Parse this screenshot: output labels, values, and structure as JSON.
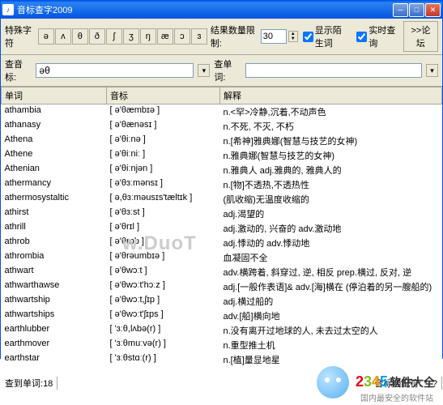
{
  "title": "音标查字2009",
  "toolbar": {
    "special_chars_label": "特殊字符",
    "phonetic_buttons": [
      "ə",
      "ʌ",
      "θ",
      "ð",
      "ʃ",
      "ʒ",
      "ŋ",
      "æ",
      "ɔ",
      "ɜ"
    ],
    "result_limit_label": "结果数量限制:",
    "result_limit_value": "30",
    "show_unknown_label": "显示陌生词",
    "show_unknown_checked": true,
    "realtime_label": "实时查询",
    "realtime_checked": true,
    "forum_label": ">>论坛"
  },
  "search": {
    "phonetic_label": "查音标:",
    "phonetic_value": "əθ",
    "word_label": "查单词:",
    "word_value": ""
  },
  "columns": {
    "word": "单词",
    "phonetic": "音标",
    "meaning": "解释"
  },
  "rows": [
    {
      "w": "athambia",
      "p": "[ ə'θæmbɪə ]",
      "m": "n.<罕>冷静,沉着,不动声色"
    },
    {
      "w": "athanasy",
      "p": "[ ə'θænəsɪ ]",
      "m": "n.不死, 不灭, 不朽"
    },
    {
      "w": "Athena",
      "p": "[ ə'θiːnə ]",
      "m": "n.[希神]雅典娜(智慧与技艺的女神)"
    },
    {
      "w": "Athene",
      "p": "[ ə'θiːniː ]",
      "m": "n.雅典娜(智慧与技艺的女神)"
    },
    {
      "w": "Athenian",
      "p": "[ ə'θiːnjən ]",
      "m": "n.雅典人 adj.雅典的, 雅典人的"
    },
    {
      "w": "athermancy",
      "p": "[ ə'θɜːmənsɪ ]",
      "m": "n.[物]不透热,不透热性"
    },
    {
      "w": "athermosystaltic",
      "p": "[ ə,θɜːməusɪs'tæltɪk ]",
      "m": "(肌收缩)无温度收缩的"
    },
    {
      "w": "athirst",
      "p": "[ ə'θɜːst ]",
      "m": "adj.渴望的"
    },
    {
      "w": "athrill",
      "p": "[ ə'θrɪl ]",
      "m": "adj.激动的, 兴奋的 adv.激动地"
    },
    {
      "w": "athrob",
      "p": "[ ə'θrɒb ]",
      "m": "adj.悸动的 adv.悸动地"
    },
    {
      "w": "athrombia",
      "p": "[ ə'θrəumbɪə ]",
      "m": "血凝固不全"
    },
    {
      "w": "athwart",
      "p": "[ ə'θwɔːt ]",
      "m": "adv.横跨着, 斜穿过, 逆, 相反 prep.横过, 反对, 逆"
    },
    {
      "w": "athwarthawse",
      "p": "[ ə'θwɔːt'hɔːz ]",
      "m": "adj.[一般作表语]& adv.[海]横在 (停泊着的另一艘船的)"
    },
    {
      "w": "athwartship",
      "p": "[ ə'θwɔːt,ʃɪp ]",
      "m": "adj.横过船的"
    },
    {
      "w": "athwartships",
      "p": "[ ə'θwɔːt'ʃɪps ]",
      "m": "adv.[船]横向地"
    },
    {
      "w": "earthlubber",
      "p": "[ 'ɜːθ,lʌbə(r) ]",
      "m": "n.没有离开过地球的人, 未去过太空的人"
    },
    {
      "w": "earthmover",
      "p": "[ 'ɜːθmuːvə(r) ]",
      "m": "n.重型推土机"
    },
    {
      "w": "earthstar",
      "p": "[ 'ɜːθstɑː(r) ]",
      "m": "n.[植]量显地星"
    }
  ],
  "status": {
    "count_label": "查到单词:",
    "count_value": "18",
    "match_label": "音标通配符:",
    "match_value": "*, ?"
  },
  "footer": {
    "brand": "2345",
    "brand_suffix": "软件大全",
    "slogan": "国内最安全的软件站"
  },
  "watermark": "w.DuoT"
}
